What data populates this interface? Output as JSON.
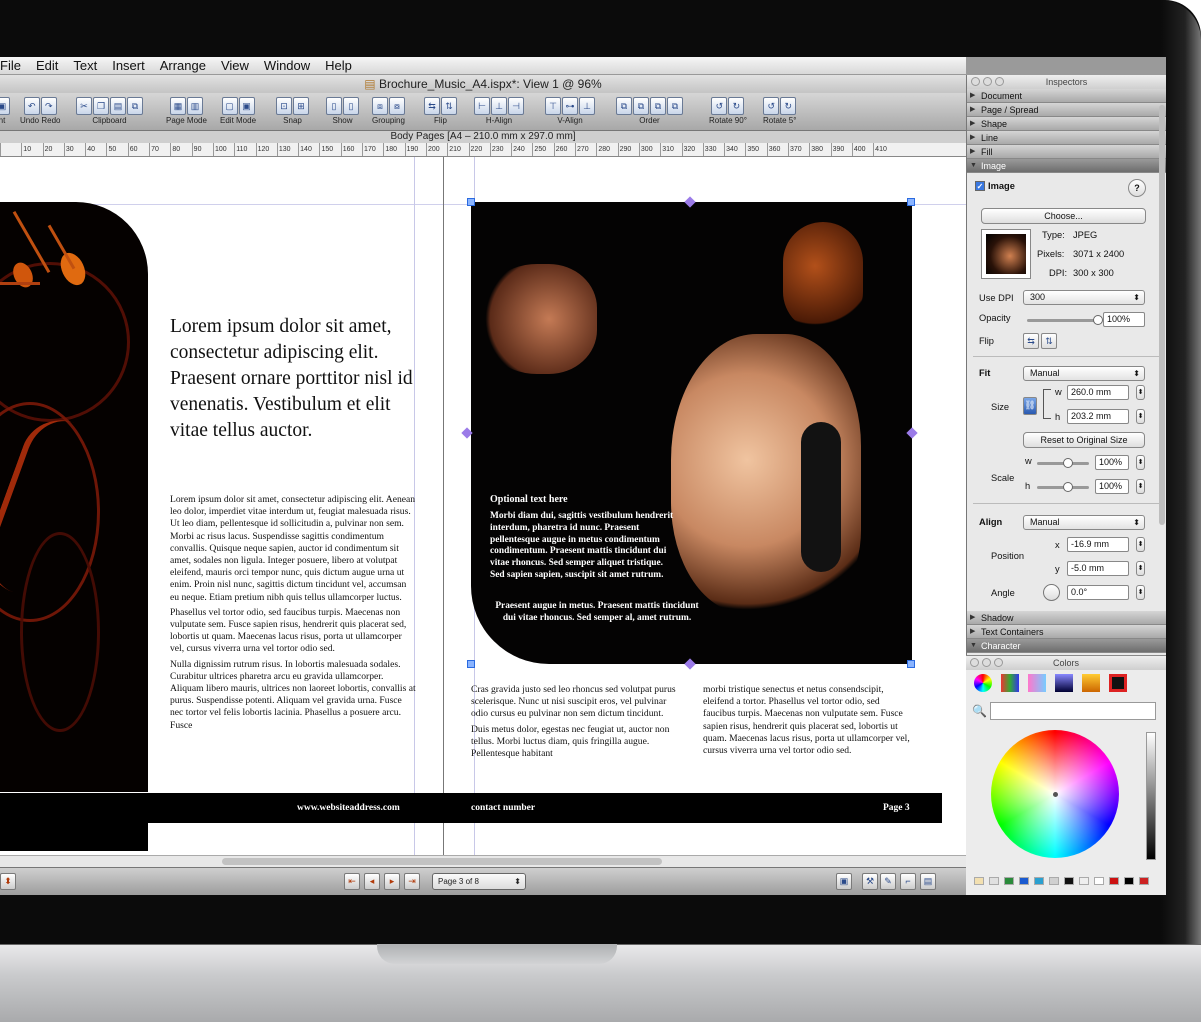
{
  "menu": [
    "File",
    "Edit",
    "Text",
    "Insert",
    "Arrange",
    "View",
    "Window",
    "Help"
  ],
  "window_title": "Brochure_Music_A4.ispx*: View 1 @ 96%",
  "toolbar_labels": [
    "nt",
    "Undo Redo",
    "Clipboard",
    "Page Mode",
    "Edit Mode",
    "Snap",
    "Show",
    "Grouping",
    "Flip",
    "H-Align",
    "V-Align",
    "Order",
    "Rotate 90°",
    "Rotate 5°"
  ],
  "pagebar_text": "Body Pages [A4 – 210.0 mm x 297.0 mm]",
  "ruler_ticks": [
    "",
    "10",
    "20",
    "30",
    "40",
    "50",
    "60",
    "70",
    "80",
    "90",
    "100",
    "110",
    "120",
    "130",
    "140",
    "150",
    "160",
    "170",
    "180",
    "190",
    "200",
    "210",
    "220",
    "230",
    "240",
    "250",
    "260",
    "270",
    "280",
    "290",
    "300",
    "310",
    "320",
    "330",
    "340",
    "350",
    "360",
    "370",
    "380",
    "390",
    "400",
    "410"
  ],
  "document": {
    "headline": "Lorem ipsum dolor sit amet, consectetur adipiscing elit. Praesent ornare porttitor nisl id venenatis. Vestibulum et elit vitae tellus auctor.",
    "body_p1": "Lorem ipsum dolor sit amet, consectetur adipiscing elit. Aenean leo dolor, imperdiet vitae interdum ut, feugiat malesuada risus. Ut leo diam, pellentesque id sollicitudin a, pulvinar non sem. Morbi ac risus lacus. Suspendisse sagittis condimentum convallis. Quisque neque sapien, auctor id condimentum sit amet, sodales non ligula. Integer posuere, libero at volutpat eleifend, mauris orci tempor nunc, quis dictum augue urna ut enim. Proin nisl nunc, sagittis dictum tincidunt vel, accumsan eu neque. Etiam pretium nibh quis tellus ullamcorper luctus.",
    "body_p2": "Phasellus vel tortor odio, sed faucibus turpis. Maecenas non vulputate sem. Fusce sapien risus, hendrerit quis placerat sed, lobortis ut quam. Maecenas lacus risus, porta ut ullamcorper vel, cursus viverra urna vel tortor odio sed.",
    "body_p3": "Nulla dignissim rutrum risus. In lobortis malesuada sodales. Curabitur ultrices pharetra arcu eu gravida ullamcorper. Aliquam libero mauris, ultrices non laoreet lobortis, convallis at purus. Suspendisse potenti. Aliquam vel gravida urna. Fusce nec tortor vel felis lobortis lacinia. Phasellus a posuere arcu. Fusce",
    "optional_title": "Optional text here",
    "optional_body": "Morbi diam dui, sagittis vestibulum hendrerit interdum, pharetra id nunc. Praesent pellentesque augue in metus condimentum condimentum. Praesent mattis tincidunt dui vitae rhoncus. Sed semper aliquet tristique. Sed sapien sapien, suscipit sit amet rutrum.",
    "optional_body2": "Praesent augue in metus. Praesent mattis tincidunt dui vitae rhoncus. Sed semper al, amet rutrum.",
    "col2_p1": "Cras gravida justo sed leo rhoncus sed volutpat purus scelerisque. Nunc ut nisi suscipit eros, vel pulvinar odio cursus eu pulvinar non sem dictum tincidunt.",
    "col2_p2": "Duis metus dolor, egestas nec feugiat ut, auctor non tellus. Morbi luctus diam, quis fringilla augue. Pellentesque habitant",
    "col3_p1": "morbi tristique senectus et netus consendscipit, eleifend a tortor. Phasellus vel tortor odio, sed faucibus turpis. Maecenas non vulputate sem. Fusce sapien risus, hendrerit quis placerat sed, lobortis ut quam. Maecenas lacus risus, porta ut ullamcorper vel, cursus viverra urna vel tortor odio sed.",
    "footer_web": "www.websiteaddress.com",
    "footer_contact": "contact number",
    "footer_page": "Page 3"
  },
  "bottombar": {
    "page_select": "Page 3 of 8"
  },
  "inspector": {
    "title": "Inspectors",
    "sections_top": [
      "Document",
      "Page / Spread",
      "Shape",
      "Line",
      "Fill"
    ],
    "image_section": "Image",
    "image_checkbox": "Image",
    "help": "?",
    "choose_button": "Choose...",
    "type_label": "Type:",
    "type_value": "JPEG",
    "pixels_label": "Pixels:",
    "pixels_value": "3071 x 2400",
    "dpi_label": "DPI:",
    "dpi_value": "300 x 300",
    "use_dpi_label": "Use DPI",
    "use_dpi_value": "300",
    "opacity_label": "Opacity",
    "opacity_value": "100%",
    "opacity_level": 1.0,
    "flip_label": "Flip",
    "fit_label": "Fit",
    "fit_value": "Manual",
    "size_label": "Size",
    "w_label": "w",
    "w_value": "260.0 mm",
    "h_label": "h",
    "h_value": "203.2 mm",
    "reset_button": "Reset to Original Size",
    "scale_label": "Scale",
    "scale_w": "100%",
    "scale_h": "100%",
    "align_label": "Align",
    "align_value": "Manual",
    "position_label": "Position",
    "x_label": "x",
    "x_value": "-16.9 mm",
    "y_label": "y",
    "y_value": "-5.0 mm",
    "angle_label": "Angle",
    "angle_value": "0.0°",
    "sections_bottom": [
      "Shadow",
      "Text Containers",
      "Character"
    ]
  },
  "colors_panel": {
    "title": "Colors"
  },
  "swatch_colors": [
    "#f3e0b0",
    "#e0e0e0",
    "#2a8a3a",
    "#1a5ad0",
    "#2aa0d0",
    "#d0d0d0",
    "#111111",
    "#eeeeee",
    "#ffffff",
    "#cc1111",
    "#000000",
    "#cc2222"
  ]
}
